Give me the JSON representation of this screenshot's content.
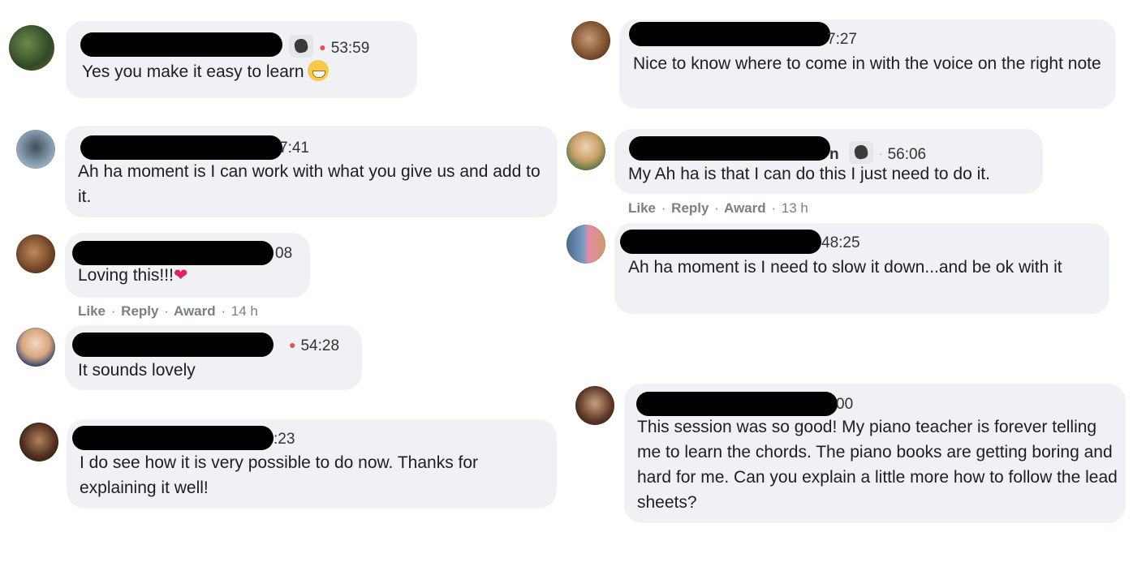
{
  "comments": {
    "c1": {
      "time": "53:59",
      "text": "Yes you make it easy to learn",
      "emoji": "grinning-face"
    },
    "c2": {
      "time": "7:41",
      "text": "Ah ha moment is I can work with what you give us and add to it."
    },
    "c3": {
      "time": "08",
      "text": "Loving this!!!",
      "heart": "❤",
      "actions": {
        "like": "Like",
        "reply": "Reply",
        "award": "Award",
        "age": "14 h"
      }
    },
    "c4": {
      "time": "54:28",
      "text": "It sounds lovely"
    },
    "c5": {
      "time": ":23",
      "text": "I do see how it is very possible to do now. Thanks for explaining it well!"
    },
    "c6": {
      "time": "7:27",
      "text": "Nice to know where to come in with the voice on the right note"
    },
    "c7": {
      "name_tail": "n",
      "time": "56:06",
      "text": "My Ah ha is that I can do this I just need to do it.",
      "actions": {
        "like": "Like",
        "reply": "Reply",
        "award": "Award",
        "age": "13 h"
      }
    },
    "c8": {
      "time": "48:25",
      "text": "Ah ha moment is I need to slow it down...and be ok with it"
    },
    "c9": {
      "time": "00",
      "text": "This session was so good! My piano teacher is forever telling me to learn the chords. The piano books are getting boring and hard for me. Can you explain a little more how to follow the lead sheets?"
    }
  },
  "separator": "·",
  "colors": {
    "bubble": "#eff1f4",
    "redaction": "#000000",
    "action_text": "#7b7f85",
    "time_dot": "#e0544f"
  }
}
